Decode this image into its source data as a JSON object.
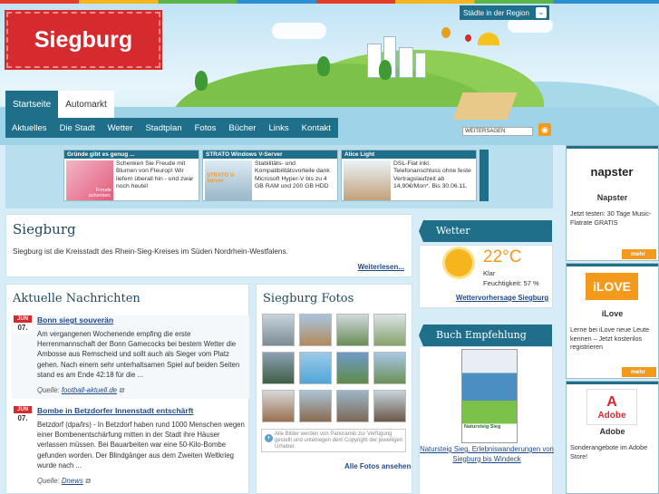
{
  "header": {
    "logo_text": "Siegburg",
    "region_button": "Städte in der Region"
  },
  "tabs": [
    {
      "label": "Startseite",
      "active": true
    },
    {
      "label": "Automarkt",
      "active": false
    }
  ],
  "nav": [
    "Aktuelles",
    "Die Stadt",
    "Wetter",
    "Stadtplan",
    "Fotos",
    "Bücher",
    "Links",
    "Kontakt"
  ],
  "share_label": "WEITERSAGEN",
  "ads": [
    {
      "title": "Gründe gibt es genug ...",
      "text": "Schenken Sie Freude mit Blumen von Fleurop! Wir liefern überall hin - und zwar noch heute!",
      "img_caption": "Freude schenken."
    },
    {
      "title": "STRATO Windows V-Server",
      "text": "Stabilitäts- und Kompatibilitätsvorteile dank Microsoft Hyper-V bis zu 4 GB RAM und 200 GB HDD",
      "img_caption": "STRATO V-Server"
    },
    {
      "title": "Alice Light",
      "text": "DSL-Flat inkl. Telefonanschluss ohne feste Vertragslaufzeit ab 14,90€/Mon*. Bis 30.06.11.",
      "img_caption": ""
    }
  ],
  "intro": {
    "title": "Siegburg",
    "text": "Siegburg ist die Kreisstadt des Rhein-Sieg-Kreises im Süden Nordrhein-Westfalens.",
    "more": "Weiterlesen..."
  },
  "news": {
    "title": "Aktuelle Nachrichten",
    "items": [
      {
        "month": "JUN",
        "day": "07.",
        "headline": "Bonn siegt souverän",
        "body": "Am vergangenen Wochenende empfing die erste Herrenmannschaft der Bonn Gamecocks bei bestem Wetter die Ambosse aus Remscheid und sollt auch als Sieger vom Platz gehen. Nach einem sehr unterhaltsamen Spiel auf beiden Seiten stand es am Ende 42:18 für die ...",
        "source_label": "Quelle:",
        "source": "football-aktuell.de"
      },
      {
        "month": "JUN",
        "day": "07.",
        "headline": "Bombe in Betzdorfer Innenstadt entschärft",
        "body": "Betzdorf (dpa/lrs) - In Betzdorf haben rund 1000 Menschen wegen einer Bombenentschärfung mitten in der Stadt ihre Häuser verlassen müssen. Bei Bauarbeiten war eine 50-Kilo-Bombe gefunden worden. Der Blindgänger aus dem Zweiten Weltkrieg wurde nach ...",
        "source_label": "Quelle:",
        "source": "Dnews"
      }
    ]
  },
  "photos": {
    "title": "Siegburg Fotos",
    "note": "Alle Bilder werden von Panoramio zur Verfügung gestellt und unterliegen dem Copyright der jeweiligen Urheber.",
    "all_link": "Alle Fotos ansehen"
  },
  "weather": {
    "title": "Wetter",
    "temp": "22°C",
    "condition": "Klar",
    "humidity": "Feuchtigkeit: 57 %",
    "link": "Wettervorhersage Siegburg"
  },
  "book": {
    "title": "Buch Empfehlung",
    "cover_text": "Natursteig Sieg",
    "link": "Natursteig Sieg. Erlebniswanderungen von Siegburg bis Windeck"
  },
  "right_ads": [
    {
      "logo": "napster",
      "name": "Napster",
      "desc": "Jetzt testen: 30 Tage Music-Flatrate GRATIS",
      "more": "mehr"
    },
    {
      "logo": "iLOVE",
      "name": "iLove",
      "desc": "Lerne bei iLove neue Leute kennen – Jetzt kostenlos registrieren",
      "more": "mehr"
    },
    {
      "logo": "Adobe",
      "name": "Adobe",
      "desc": "Sonderangebote im Adobe Store!",
      "more": "mehr"
    }
  ]
}
